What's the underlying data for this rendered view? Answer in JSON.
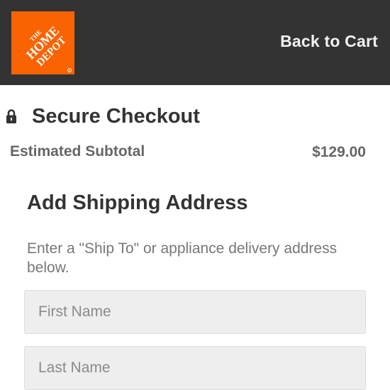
{
  "header": {
    "logo_text": "THE HOME DEPOT",
    "back_link": "Back to Cart"
  },
  "checkout": {
    "title": "Secure Checkout",
    "subtotal_label": "Estimated Subtotal",
    "subtotal_value": "$129.00"
  },
  "shipping": {
    "title": "Add Shipping Address",
    "instructions": "Enter a \"Ship To\" or appliance delivery address below.",
    "first_name": {
      "value": "",
      "placeholder": "First Name"
    },
    "last_name": {
      "value": "",
      "placeholder": "Last Name"
    }
  },
  "colors": {
    "header_bg": "#333333",
    "brand_orange": "#F96302",
    "text_dark": "#333333",
    "text_muted": "#666666",
    "field_bg": "#eeeeee"
  },
  "icons": [
    "home-depot-logo",
    "lock-icon"
  ]
}
